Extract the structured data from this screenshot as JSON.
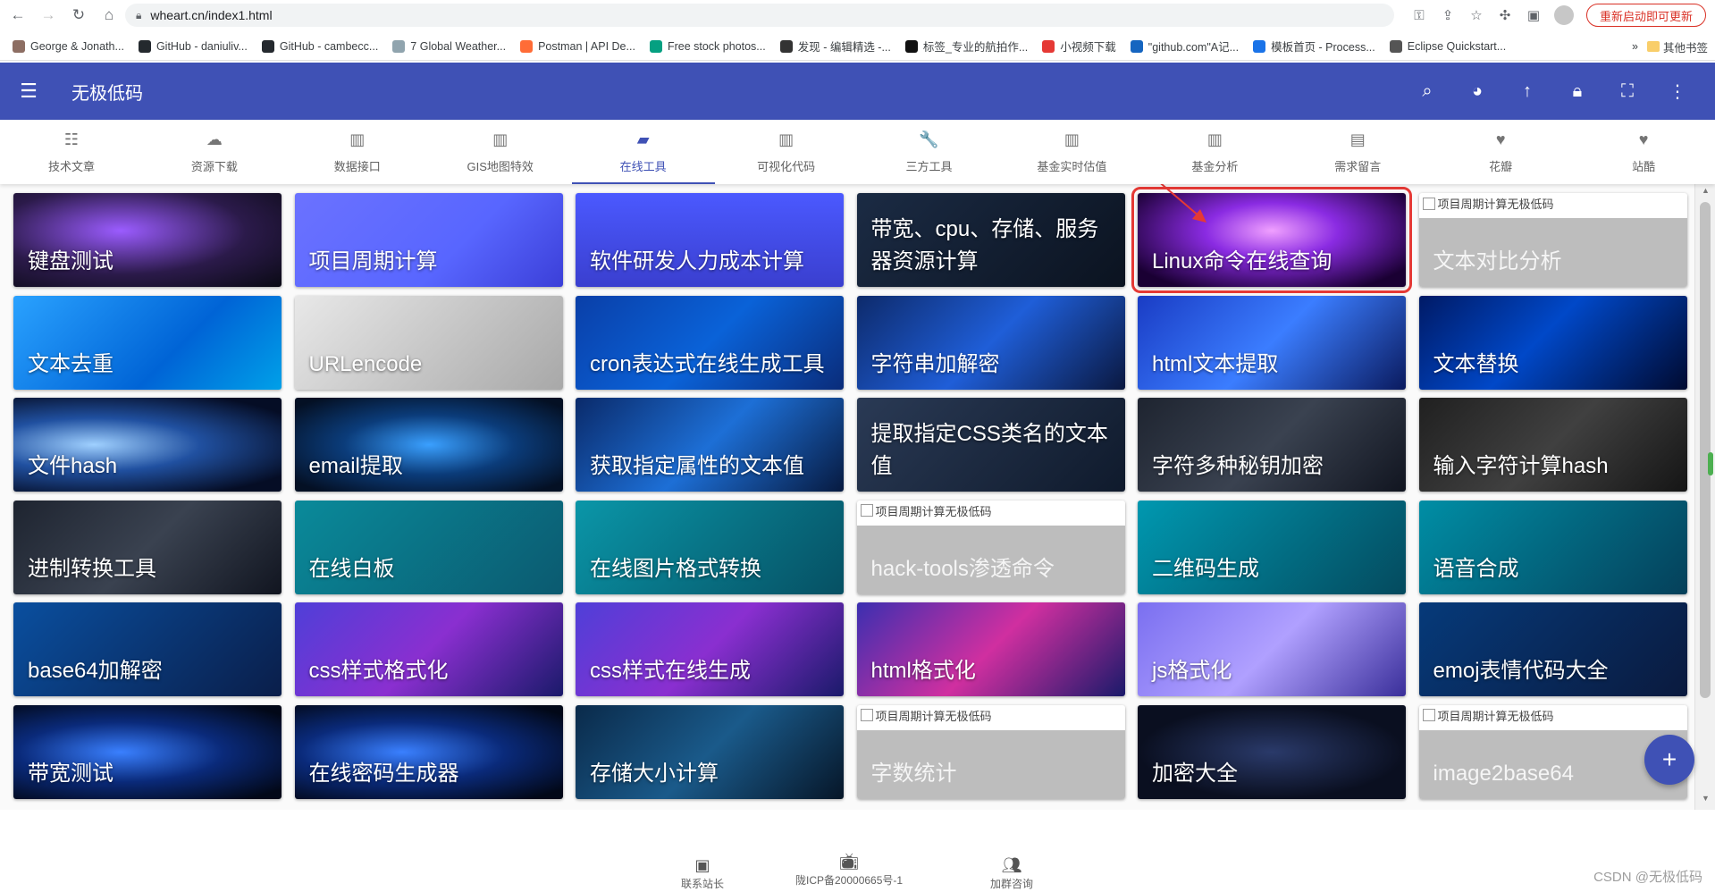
{
  "browser": {
    "url": "wheart.cn/index1.html",
    "update_button": "重新启动即可更新",
    "bookmarks": [
      {
        "label": "George & Jonath...",
        "color": "#8d6e63"
      },
      {
        "label": "GitHub - daniuliv...",
        "color": "#24292e"
      },
      {
        "label": "GitHub - cambecc...",
        "color": "#24292e"
      },
      {
        "label": "7 Global Weather...",
        "color": "#90a4ae"
      },
      {
        "label": "Postman | API De...",
        "color": "#ff6c37"
      },
      {
        "label": "Free stock photos...",
        "color": "#05a081"
      },
      {
        "label": "发现 - 编辑精选 -...",
        "color": "#333333"
      },
      {
        "label": "标签_专业的航拍作...",
        "color": "#111111"
      },
      {
        "label": "小视频下载",
        "color": "#e53935"
      },
      {
        "label": "\"github.com\"A记...",
        "color": "#1565c0"
      },
      {
        "label": "模板首页 - Process...",
        "color": "#1a73e8"
      },
      {
        "label": "Eclipse Quickstart...",
        "color": "#555555"
      }
    ],
    "bookmarks_overflow": "»",
    "other_bookmarks": "其他书签"
  },
  "header": {
    "title": "无极低码"
  },
  "tabs": [
    {
      "label": "技术文章",
      "icon": "article-icon",
      "glyph": "☷",
      "active": false
    },
    {
      "label": "资源下载",
      "icon": "cloud-download-icon",
      "glyph": "☁",
      "active": false
    },
    {
      "label": "数据接口",
      "icon": "bar-chart-icon",
      "glyph": "▥",
      "active": false
    },
    {
      "label": "GIS地图特效",
      "icon": "bar-chart-icon",
      "glyph": "▥",
      "active": false
    },
    {
      "label": "在线工具",
      "icon": "book-icon",
      "glyph": "▰",
      "active": true
    },
    {
      "label": "可视化代码",
      "icon": "bar-chart-icon",
      "glyph": "▥",
      "active": false
    },
    {
      "label": "三方工具",
      "icon": "wrench-icon",
      "glyph": "🔧",
      "active": false
    },
    {
      "label": "基金实时估值",
      "icon": "bar-chart-icon",
      "glyph": "▥",
      "active": false
    },
    {
      "label": "基金分析",
      "icon": "bar-chart-icon",
      "glyph": "▥",
      "active": false
    },
    {
      "label": "需求留言",
      "icon": "comment-icon",
      "glyph": "▤",
      "active": false
    },
    {
      "label": "花瓣",
      "icon": "heart-icon",
      "glyph": "♥",
      "active": false
    },
    {
      "label": "站酷",
      "icon": "heart-icon",
      "glyph": "♥",
      "active": false
    }
  ],
  "cards": [
    {
      "label": "键盘测试",
      "style": "g0",
      "broken": false
    },
    {
      "label": "项目周期计算",
      "style": "g1",
      "broken": false
    },
    {
      "label": "软件研发人力成本计算",
      "style": "g2",
      "broken": false
    },
    {
      "label": "带宽、cpu、存储、服务器资源计算",
      "style": "g3",
      "broken": false
    },
    {
      "label": "Linux命令在线查询",
      "style": "g4",
      "broken": false,
      "highlighted": true
    },
    {
      "label": "文本对比分析",
      "style": "",
      "broken": true
    },
    {
      "label": "文本去重",
      "style": "g5",
      "broken": false
    },
    {
      "label": "URLencode",
      "style": "g6",
      "broken": false
    },
    {
      "label": "cron表达式在线生成工具",
      "style": "g7",
      "broken": false
    },
    {
      "label": "字符串加解密",
      "style": "g8",
      "broken": false
    },
    {
      "label": "html文本提取",
      "style": "g9",
      "broken": false
    },
    {
      "label": "文本替换",
      "style": "g10",
      "broken": false
    },
    {
      "label": "文件hash",
      "style": "g11",
      "broken": false
    },
    {
      "label": "email提取",
      "style": "g12",
      "broken": false
    },
    {
      "label": "获取指定属性的文本值",
      "style": "g13",
      "broken": false
    },
    {
      "label": "提取指定CSS类名的文本值",
      "style": "g14",
      "broken": false
    },
    {
      "label": "字符多种秘钥加密",
      "style": "g15",
      "broken": false
    },
    {
      "label": "输入字符计算hash",
      "style": "g16",
      "broken": false
    },
    {
      "label": "进制转换工具",
      "style": "g15",
      "broken": false
    },
    {
      "label": "在线白板",
      "style": "g17",
      "broken": false
    },
    {
      "label": "在线图片格式转换",
      "style": "g18",
      "broken": false
    },
    {
      "label": "hack-tools渗透命令",
      "style": "",
      "broken": true
    },
    {
      "label": "二维码生成",
      "style": "g19",
      "broken": false
    },
    {
      "label": "语音合成",
      "style": "g20",
      "broken": false
    },
    {
      "label": "base64加解密",
      "style": "g21",
      "broken": false
    },
    {
      "label": "css样式格式化",
      "style": "g22",
      "broken": false
    },
    {
      "label": "css样式在线生成",
      "style": "g23",
      "broken": false
    },
    {
      "label": "html格式化",
      "style": "g24",
      "broken": false
    },
    {
      "label": "js格式化",
      "style": "g25",
      "broken": false
    },
    {
      "label": "emoj表情代码大全",
      "style": "g26",
      "broken": false
    },
    {
      "label": "带宽测试",
      "style": "g27",
      "broken": false
    },
    {
      "label": "在线密码生成器",
      "style": "g28",
      "broken": false
    },
    {
      "label": "存储大小计算",
      "style": "g29",
      "broken": false
    },
    {
      "label": "字数统计",
      "style": "",
      "broken": true
    },
    {
      "label": "加密大全",
      "style": "g30",
      "broken": false
    },
    {
      "label": "image2base64",
      "style": "",
      "broken": true
    }
  ],
  "broken_image_alt": "项目周期计算无极低码",
  "fab": "+",
  "footer": {
    "contact": "联系站长",
    "icp": "陇ICP备20000665号-1",
    "group": "加群咨询"
  },
  "watermark": "CSDN @无极低码"
}
